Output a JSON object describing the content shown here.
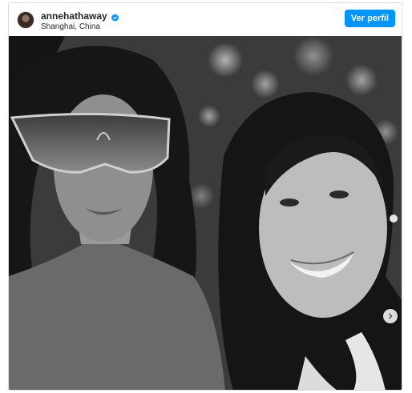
{
  "post": {
    "username": "annehathaway",
    "location": "Shanghai, China",
    "view_profile_label": "Ver perfil"
  },
  "icons": {
    "verified": "verified-badge-icon",
    "next": "chevron-right-icon"
  },
  "colors": {
    "accent": "#0095f6",
    "text": "#262626",
    "border": "#dbdbdb"
  }
}
